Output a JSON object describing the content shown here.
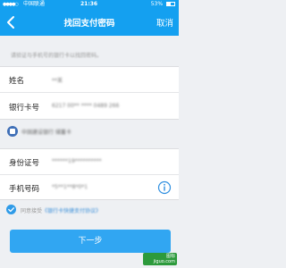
{
  "status_bar": {
    "carrier": "中国联通",
    "time": "21:36",
    "battery": "53%",
    "battery_level": 0.53
  },
  "nav": {
    "title": "找回支付密码",
    "cancel_label": "取消",
    "back_icon": "chevron-left-icon"
  },
  "hint": "请验证与手机号的银行卡以找回密码。",
  "form": {
    "name_label": "姓名",
    "name_value": "**某",
    "card_label": "银行卡号",
    "card_value": "6217 00** **** 0489 266",
    "id_label": "身份证号",
    "id_value": "******19**********",
    "phone_label": "手机号码",
    "phone_value": "*5**1**8*0*1",
    "info_icon": "info-icon"
  },
  "bank": {
    "name": "中国建设银行 储蓄卡",
    "logo_icon": "bank-logo-icon"
  },
  "agreement": {
    "prefix": "同意接受",
    "link_text": "《银行卡快捷支付协议》",
    "checked": true
  },
  "next_button": "下一步",
  "watermark": {
    "line1": "图标",
    "line2": "jiguo.com"
  },
  "colors": {
    "primary": "#14a0f0",
    "button": "#31a6f2",
    "background": "#eef0f3"
  }
}
